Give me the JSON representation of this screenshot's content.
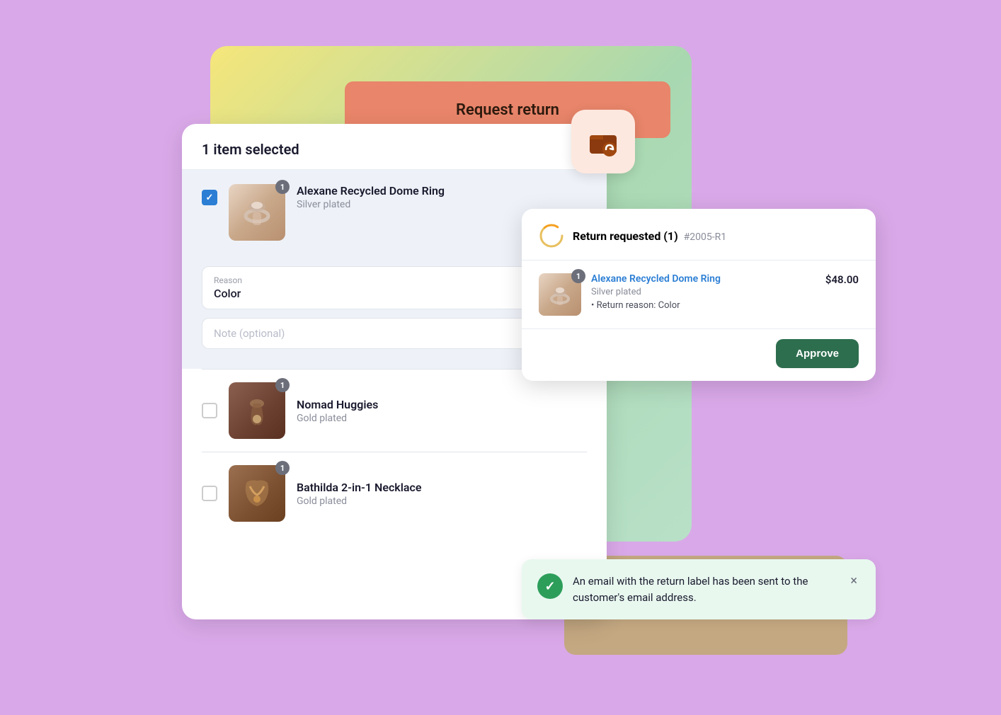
{
  "background_color": "#d9a8e8",
  "request_return_title": "Request return",
  "app_icon_color": "#fde8df",
  "main_card": {
    "items_selected": "1 item selected",
    "item1": {
      "name": "Alexane Recycled Dome Ring",
      "variant": "Silver plated",
      "badge": "1",
      "checked": true
    },
    "reason_label": "Reason",
    "reason_value": "Color",
    "note_placeholder": "Note (optional)",
    "item2": {
      "name": "Nomad Huggies",
      "variant": "Gold plated",
      "badge": "1",
      "checked": false
    },
    "item3": {
      "name": "Bathilda 2-in-1 Necklace",
      "variant": "Gold plated",
      "badge": "1",
      "checked": false
    }
  },
  "return_card": {
    "title": "Return requested (1)",
    "ref": "#2005-R1",
    "item_name": "Alexane Recycled Dome Ring",
    "item_variant": "Silver plated",
    "return_reason_label": "Return reason: Color",
    "price": "$48.00",
    "badge": "1",
    "approve_label": "Approve"
  },
  "notification": {
    "message": "An email with the return label has been sent to the customer's email address.",
    "close_label": "×"
  }
}
